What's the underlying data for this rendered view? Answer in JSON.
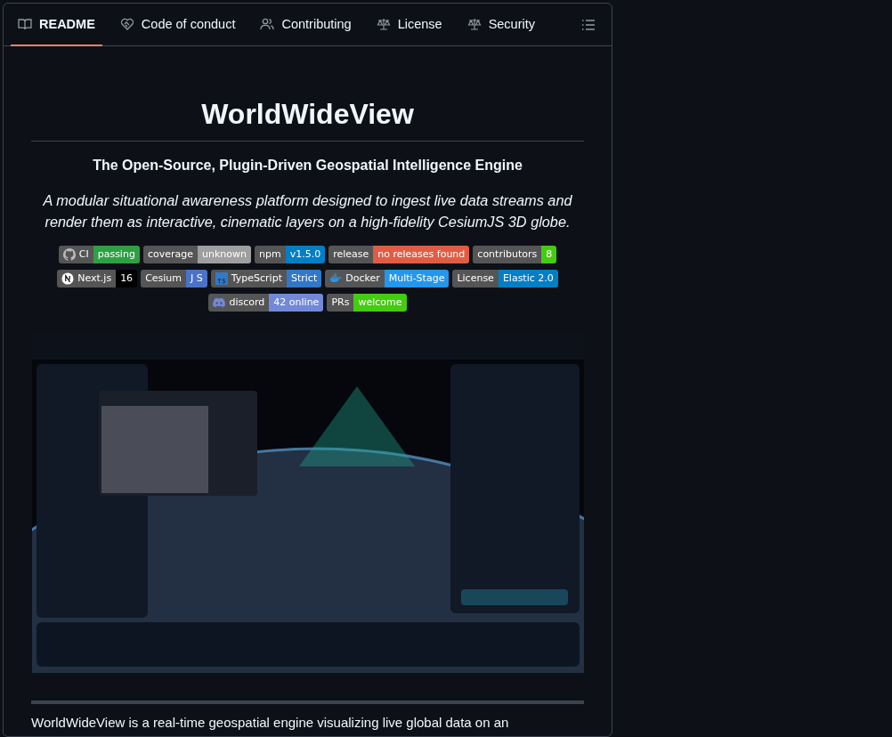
{
  "tabs": [
    {
      "label": "README",
      "selected": true,
      "kind": "book"
    },
    {
      "label": "Code of conduct",
      "selected": false,
      "kind": "heart"
    },
    {
      "label": "Contributing",
      "selected": false,
      "kind": "people"
    },
    {
      "label": "License",
      "selected": false,
      "kind": "scale"
    },
    {
      "label": "Security",
      "selected": false,
      "kind": "scale"
    }
  ],
  "title": "WorldWideView",
  "subtitle": "The Open-Source, Plugin-Driven Geospatial Intelligence Engine",
  "tagline": "A modular situational awareness platform designed to ingest live data streams and render them as interactive, cinematic layers on a high-fidelity CesiumJS 3D globe.",
  "badge_rows": [
    [
      {
        "label": "CI",
        "message": "passing",
        "color": "#2ea043",
        "kind": "github"
      },
      {
        "label": "coverage",
        "message": "unknown",
        "color": "#9f9f9f",
        "kind": "plain"
      },
      {
        "label": "npm",
        "message": "v1.5.0",
        "color": "#007ec6",
        "kind": "plain"
      },
      {
        "label": "release",
        "message": "no releases found",
        "color": "#e05d44",
        "kind": "plain"
      },
      {
        "label": "contributors",
        "message": "8",
        "color": "#44cc11",
        "kind": "plain"
      }
    ],
    [
      {
        "label": "Next.js",
        "message": "16",
        "color": "#000000",
        "kind": "next"
      },
      {
        "label": "Cesium",
        "message": "J S",
        "color": "#4a72c9",
        "kind": "plain"
      },
      {
        "label": "TypeScript",
        "message": "Strict",
        "color": "#3178c6",
        "kind": "ts"
      },
      {
        "label": "Docker",
        "message": "Multi-Stage",
        "color": "#2496ed",
        "kind": "docker"
      },
      {
        "label": "License",
        "message": "Elastic 2.0",
        "color": "#007ec6",
        "kind": "plain"
      }
    ],
    [
      {
        "label": "discord",
        "message": "42 online",
        "color": "#7289da",
        "kind": "discord"
      },
      {
        "label": "PRs",
        "message": "welcome",
        "color": "#44cc11",
        "kind": "plain"
      }
    ]
  ],
  "intro": "WorldWideView is a real-time geospatial engine visualizing live global data on an"
}
